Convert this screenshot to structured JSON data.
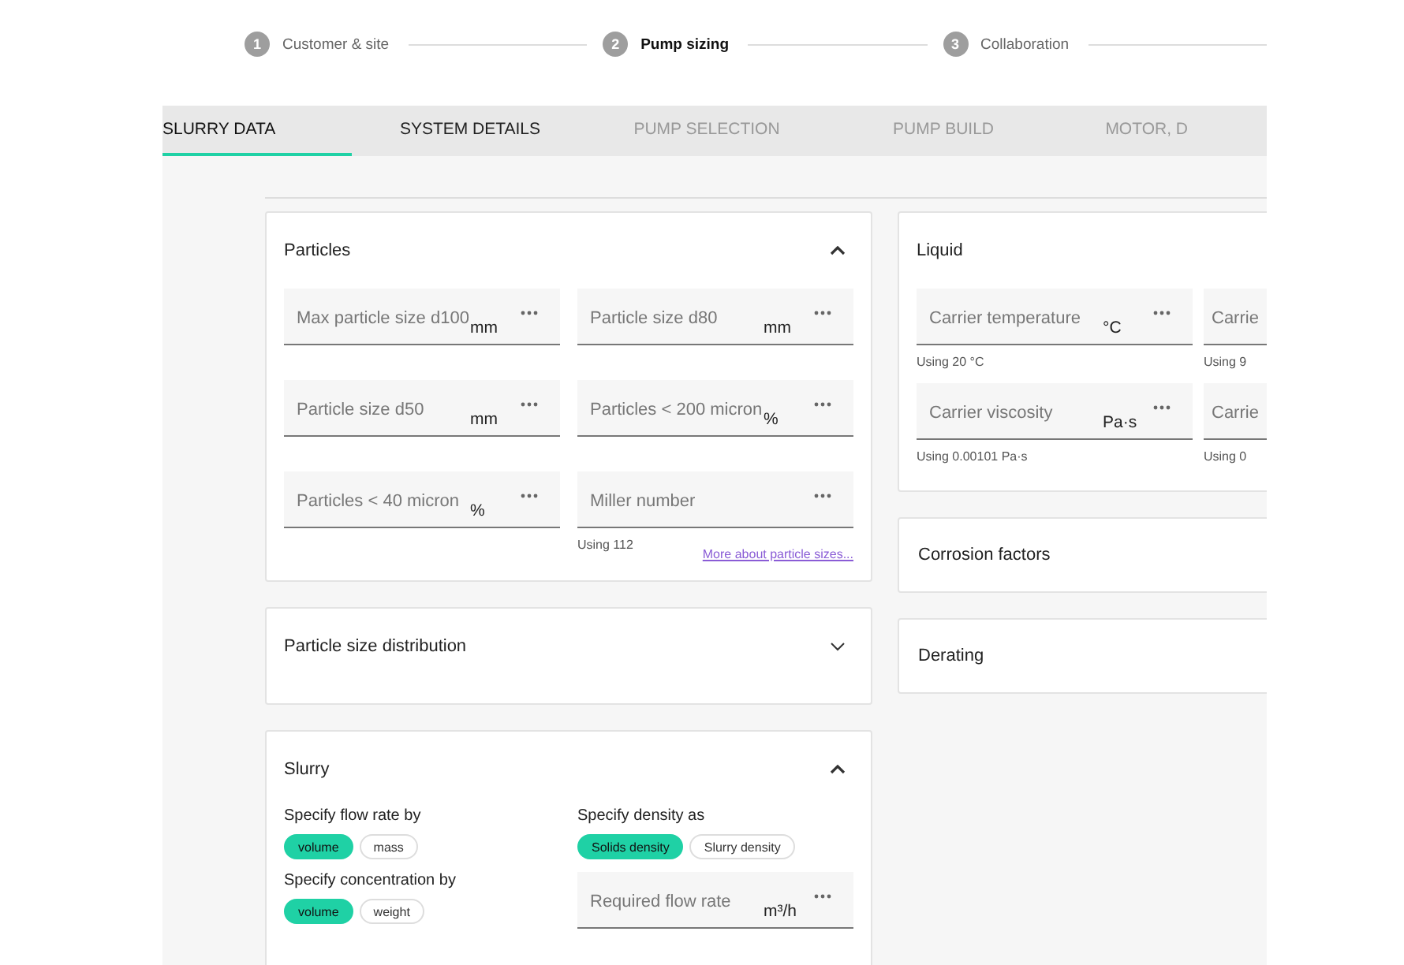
{
  "stepper": [
    {
      "number": "1",
      "label": "Customer & site",
      "selected": false
    },
    {
      "number": "2",
      "label": "Pump sizing",
      "selected": true
    },
    {
      "number": "3",
      "label": "Collaboration",
      "selected": false
    }
  ],
  "tabs": [
    {
      "label": "SLURRY DATA",
      "selected": true,
      "disabled": false
    },
    {
      "label": "SYSTEM DETAILS",
      "selected": false,
      "disabled": false
    },
    {
      "label": "PUMP SELECTION",
      "selected": false,
      "disabled": true
    },
    {
      "label": "PUMP BUILD",
      "selected": false,
      "disabled": true
    },
    {
      "label": "MOTOR, D",
      "selected": false,
      "disabled": true
    }
  ],
  "left_cards": [
    {
      "title": "Particles",
      "expanded": true,
      "fields": [
        {
          "placeholder": "Max particle size d100",
          "unit": "mm"
        },
        {
          "placeholder": "Particle size d80",
          "unit": "mm"
        },
        {
          "placeholder": "Particle size d50",
          "unit": "mm"
        },
        {
          "placeholder": "Particles < 200 micron",
          "unit": "%"
        },
        {
          "placeholder": "Particles < 40 micron",
          "unit": "%"
        },
        {
          "placeholder": "Miller number",
          "helper": "Using 112"
        }
      ],
      "link": "More about particle sizes..."
    },
    {
      "title": "Particle size distribution",
      "expanded": false
    }
  ],
  "slurry": {
    "title": "Slurry",
    "expanded": true,
    "toggles": [
      {
        "label": "Specify flow rate by",
        "options": [
          {
            "label": "volume",
            "selected": true
          },
          {
            "label": "mass",
            "selected": false
          }
        ]
      },
      {
        "label": "Specify density as",
        "options": [
          {
            "label": "Solids density",
            "selected": true
          },
          {
            "label": "Slurry density",
            "selected": false
          }
        ]
      },
      {
        "label": "Specify concentration by",
        "options": [
          {
            "label": "volume",
            "selected": true
          },
          {
            "label": "weight",
            "selected": false
          }
        ]
      }
    ],
    "field": {
      "placeholder": "Required flow rate",
      "unit": "m³/h"
    }
  },
  "liquid": {
    "title": "Liquid",
    "fields": [
      {
        "placeholder": "Carrier temperature",
        "unit": "°C",
        "helper": "Using 20 °C"
      },
      {
        "placeholder": "Carrie",
        "helper": "Using 9"
      },
      {
        "placeholder": "Carrier viscosity",
        "unit": "Pa·s",
        "helper": "Using 0.00101 Pa·s"
      },
      {
        "placeholder": "Carrie",
        "helper": "Using 0"
      }
    ]
  },
  "right_cards": [
    {
      "title": "Corrosion factors"
    },
    {
      "title": "Derating"
    }
  ]
}
